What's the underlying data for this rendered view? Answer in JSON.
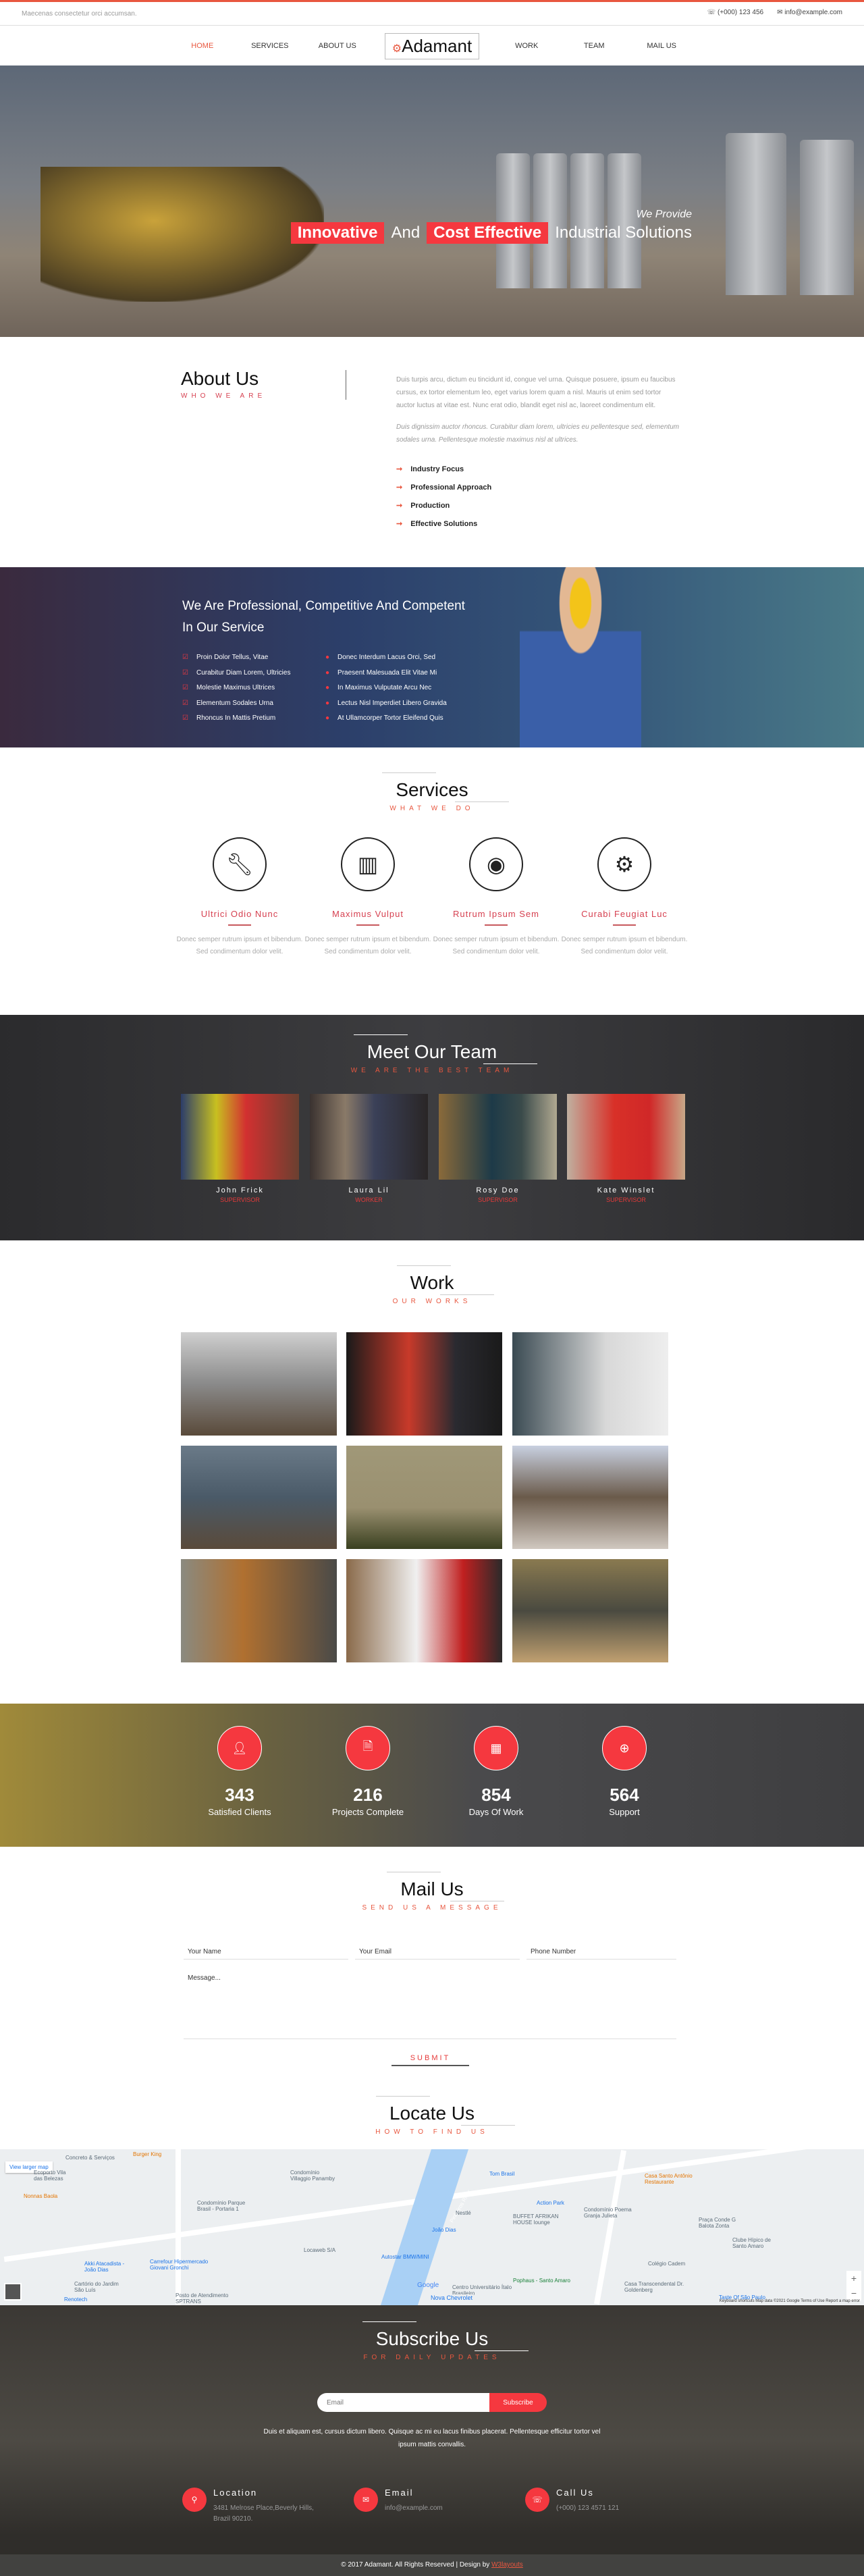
{
  "topbar": {
    "tagline": "Maecenas consectetur orci accumsan.",
    "phone": "(+000) 123 456",
    "email": "info@example.com"
  },
  "nav": {
    "items": [
      "HOME",
      "SERVICES",
      "ABOUT US",
      "WORK",
      "TEAM",
      "MAIL US"
    ],
    "logo": "Adamant",
    "active": "HOME"
  },
  "hero": {
    "sub": "We Provide",
    "hl1": "Innovative",
    "and": "And",
    "hl2": "Cost Effective",
    "rest": "Industrial Solutions"
  },
  "about": {
    "title": "About Us",
    "subtitle": "WHO WE ARE",
    "p1": "Duis turpis arcu, dictum eu tincidunt id, congue vel urna. Quisque posuere, ipsum eu faucibus cursus, ex tortor elementum leo, eget varius lorem quam a nisl. Mauris ut enim sed tortor auctor luctus at vitae est. Nunc erat odio, blandit eget nisl ac, laoreet condimentum elit.",
    "p2": "Duis dignissim auctor rhoncus. Curabitur diam lorem, ultricies eu pellentesque sed, elementum sodales urna. Pellentesque molestie maximus nisl at ultrices.",
    "list": [
      "Industry Focus",
      "Professional Approach",
      "Production",
      "Effective Solutions"
    ]
  },
  "professional": {
    "heading": "We Are Professional, Competitive And Competent In Our Service",
    "col1": [
      "Proin Dolor Tellus, Vitae",
      "Curabitur Diam Lorem, Ultricies",
      "Molestie Maximus Ultrices",
      "Elementum Sodales Urna",
      "Rhoncus In Mattis Pretium"
    ],
    "col2": [
      "Donec Interdum Lacus Orci, Sed",
      "Praesent Malesuada Elit Vitae Mi",
      "In Maximus Vulputate Arcu Nec",
      "Lectus Nisl Imperdiet Libero Gravida",
      "At Ullamcorper Tortor Eleifend Quis"
    ]
  },
  "services": {
    "title": "Services",
    "subtitle": "WHAT WE DO",
    "items": [
      {
        "icon": "wrench-icon",
        "title": "Ultrici Odio Nunc",
        "text": "Donec semper rutrum ipsum et bibendum. Sed condimentum dolor velit."
      },
      {
        "icon": "map-icon",
        "title": "Maximus Vulput",
        "text": "Donec semper rutrum ipsum et bibendum. Sed condimentum dolor velit."
      },
      {
        "icon": "globe-icon",
        "title": "Rutrum Ipsum Sem",
        "text": "Donec semper rutrum ipsum et bibendum. Sed condimentum dolor velit."
      },
      {
        "icon": "gears-icon",
        "title": "Curabi Feugiat Luc",
        "text": "Donec semper rutrum ipsum et bibendum. Sed condimentum dolor velit."
      }
    ]
  },
  "team": {
    "title": "Meet Our Team",
    "subtitle": "WE ARE THE BEST TEAM",
    "members": [
      {
        "name": "John Frick",
        "role": "SUPERVISOR"
      },
      {
        "name": "Laura Lil",
        "role": "WORKER"
      },
      {
        "name": "Rosy Doe",
        "role": "SUPERVISOR"
      },
      {
        "name": "Kate Winslet",
        "role": "SUPERVISOR"
      }
    ]
  },
  "work": {
    "title": "Work",
    "subtitle": "OUR WORKS"
  },
  "counters": [
    {
      "icon": "user-icon",
      "value": "343",
      "label": "Satisfied Clients"
    },
    {
      "icon": "document-icon",
      "value": "216",
      "label": "Projects Complete"
    },
    {
      "icon": "calendar-icon",
      "value": "854",
      "label": "Days Of Work"
    },
    {
      "icon": "lifebuoy-icon",
      "value": "564",
      "label": "Support"
    }
  ],
  "mail": {
    "title": "Mail Us",
    "subtitle": "SEND US A MESSAGE",
    "name_ph": "Your Name",
    "email_ph": "Your Email",
    "phone_ph": "Phone Number",
    "message_ph": "Message...",
    "submit": "SUBMIT"
  },
  "locate": {
    "title": "Locate Us",
    "subtitle": "HOW TO FIND US",
    "view_larger": "View larger map",
    "labels": [
      "Concreto & Serviços",
      "Burger King",
      "Ecoporto Vila das Belezas",
      "Nonnas Baola",
      "Condomínio Villaggio Panamby",
      "Condomínio Parque Brasil - Portaria 1",
      "Pinheiros River",
      "Tom Brasil",
      "Casa Santo Antônio Restaurante",
      "Action Park",
      "Condomínio Poema Granja Julieta",
      "Nestlé",
      "BUFFET AFRIKAN HOUSE lounge",
      "João Dias",
      "Praça Conde G Balota Zonta",
      "Clube Hípico de Santo Amaro",
      "Locaweb S/A",
      "Autostar BMW/MINI",
      "Akki Atacadista - João Dias",
      "Carrefour Hipermercado Giovani Gronchi",
      "Colégio Cadem",
      "Pophaus - Santo Amaro",
      "Casa Transcendental Dr. Goldenberg",
      "Cartório do Jardim São Luís",
      "Taste Of São Paulo",
      "Renotech",
      "Posto de Atendimento SPTRANS",
      "Centro Universitário Ítalo Brasileiro",
      "Nova Chevrolet",
      "Google"
    ],
    "attribution": "Keyboard shortcuts   Map data ©2021 Google   Terms of Use   Report a map error"
  },
  "subscribe": {
    "title": "Subscribe Us",
    "subtitle": "FOR DAILY UPDATES",
    "email_ph": "Email",
    "button": "Subscribe",
    "text": "Duis et aliquam est, cursus dictum libero. Quisque ac mi eu lacus finibus placerat. Pellentesque efficitur tortor vel ipsum mattis convallis.",
    "contacts": [
      {
        "icon": "map-pin-icon",
        "title": "Location",
        "text": "3481 Melrose Place,Beverly Hills, Brazil 90210."
      },
      {
        "icon": "envelope-icon",
        "title": "Email",
        "text": "info@example.com"
      },
      {
        "icon": "phone-icon",
        "title": "Call Us",
        "text": "(+000) 123 4571 121"
      }
    ]
  },
  "footer": {
    "text": "© 2017 Adamant. All Rights Reserved | Design by ",
    "link": "W3layouts"
  },
  "colors": {
    "accent": "#f5383f",
    "nav_active": "#e8573f"
  }
}
